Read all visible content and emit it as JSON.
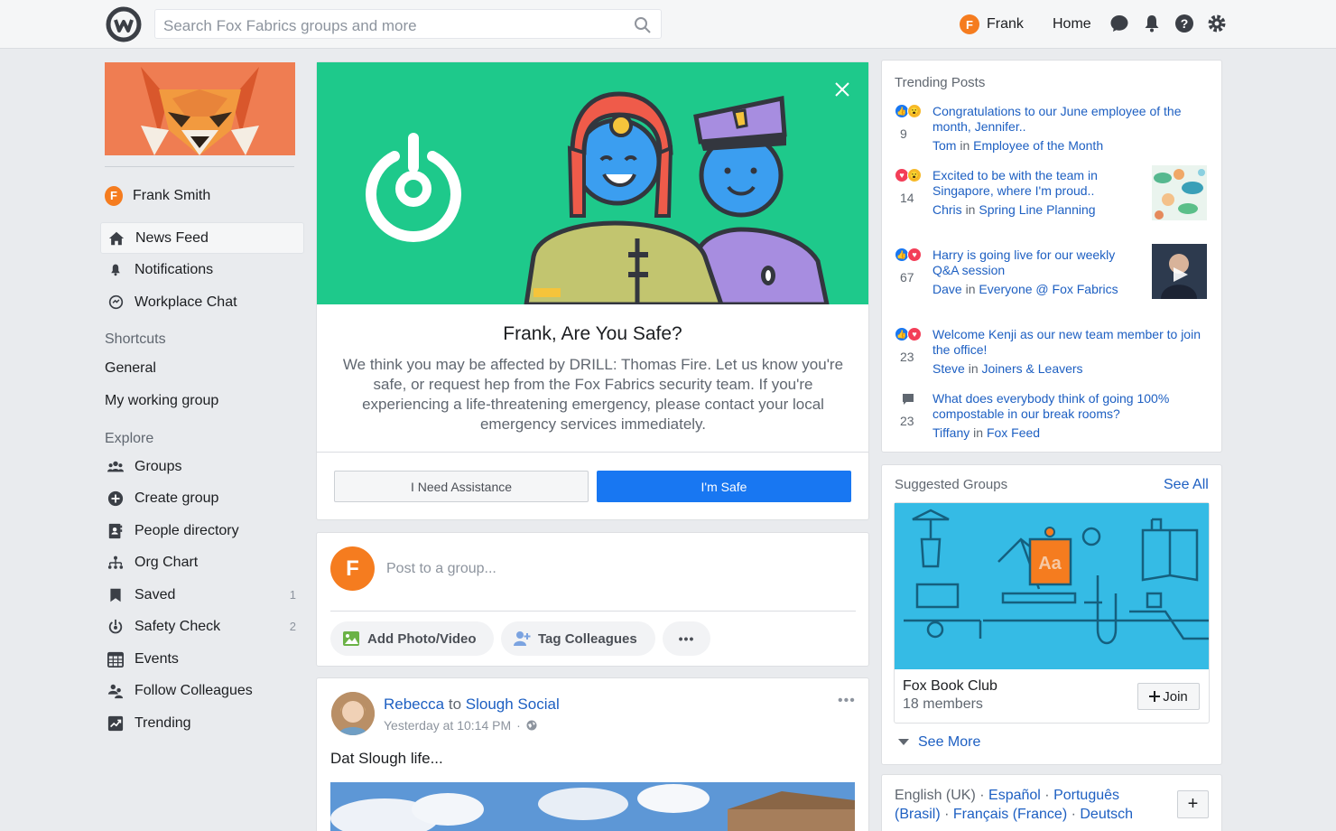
{
  "search": {
    "placeholder": "Search Fox Fabrics groups and more"
  },
  "topbar": {
    "user_name": "Frank",
    "user_initial": "F",
    "home_label": "Home"
  },
  "sidebar": {
    "profile_name": "Frank Smith",
    "profile_initial": "F",
    "main_items": [
      {
        "label": "News Feed",
        "icon": "home-icon"
      },
      {
        "label": "Notifications",
        "icon": "bell-icon"
      },
      {
        "label": "Workplace Chat",
        "icon": "chat-icon"
      }
    ],
    "shortcuts_heading": "Shortcuts",
    "shortcuts": [
      "General",
      "My working group"
    ],
    "explore_heading": "Explore",
    "explore": [
      {
        "label": "Groups",
        "icon": "groups-icon",
        "count": ""
      },
      {
        "label": "Create group",
        "icon": "plus-circle-icon",
        "count": ""
      },
      {
        "label": "People directory",
        "icon": "directory-icon",
        "count": ""
      },
      {
        "label": "Org Chart",
        "icon": "org-chart-icon",
        "count": ""
      },
      {
        "label": "Saved",
        "icon": "bookmark-icon",
        "count": "1"
      },
      {
        "label": "Safety Check",
        "icon": "safety-check-icon",
        "count": "2"
      },
      {
        "label": "Events",
        "icon": "calendar-icon",
        "count": ""
      },
      {
        "label": "Follow Colleagues",
        "icon": "follow-icon",
        "count": ""
      },
      {
        "label": "Trending",
        "icon": "trending-icon",
        "count": ""
      }
    ]
  },
  "safety": {
    "title": "Frank, Are You Safe?",
    "body": "We think you may be affected by DRILL: Thomas Fire. Let us know you're safe, or request hep from the Fox Fabrics security team. If you're experiencing a life-threatening emergency, please contact your local emergency services immediately.",
    "assist_label": "I Need Assistance",
    "safe_label": "I'm Safe"
  },
  "composer": {
    "initial": "F",
    "placeholder": "Post to a group...",
    "photo_label": "Add Photo/Video",
    "tag_label": "Tag Colleagues",
    "more_label": "•••"
  },
  "post": {
    "author": "Rebecca",
    "connector": "to",
    "group": "Slough Social",
    "time": "Yesterday at 10:14 PM",
    "dot": "·",
    "text": "Dat Slough life...",
    "menu": "•••"
  },
  "trending": {
    "title": "Trending Posts",
    "items": [
      {
        "count": "9",
        "text": "Congratulations to our June employee of the month, Jennifer..",
        "author": "Tom",
        "in": "in",
        "group": "Employee of the Month"
      },
      {
        "count": "14",
        "text": "Excited to be with the team in Singapore, where I'm proud..",
        "author": "Chris",
        "in": "in",
        "group": "Spring Line Planning"
      },
      {
        "count": "67",
        "text": "Harry is going live for our weekly Q&A session",
        "author": "Dave",
        "in": "in",
        "group": "Everyone @ Fox Fabrics"
      },
      {
        "count": "23",
        "text": "Welcome Kenji as our new team member to join the office!",
        "author": "Steve",
        "in": "in",
        "group": "Joiners & Leavers"
      },
      {
        "count": "23",
        "text": "What does everybody think of going 100% compostable in our break rooms?",
        "author": "Tiffany",
        "in": "in",
        "group": "Fox Feed"
      }
    ]
  },
  "suggested": {
    "title": "Suggested Groups",
    "see_all": "See All",
    "group_name": "Fox Book Club",
    "members": "18 members",
    "join_label": "Join",
    "see_more": "See More"
  },
  "languages": {
    "current": "English (UK)",
    "sep": " · ",
    "options": [
      "Español",
      "Português (Brasil)",
      "Français (France)",
      "Deutsch"
    ],
    "more": "+"
  }
}
